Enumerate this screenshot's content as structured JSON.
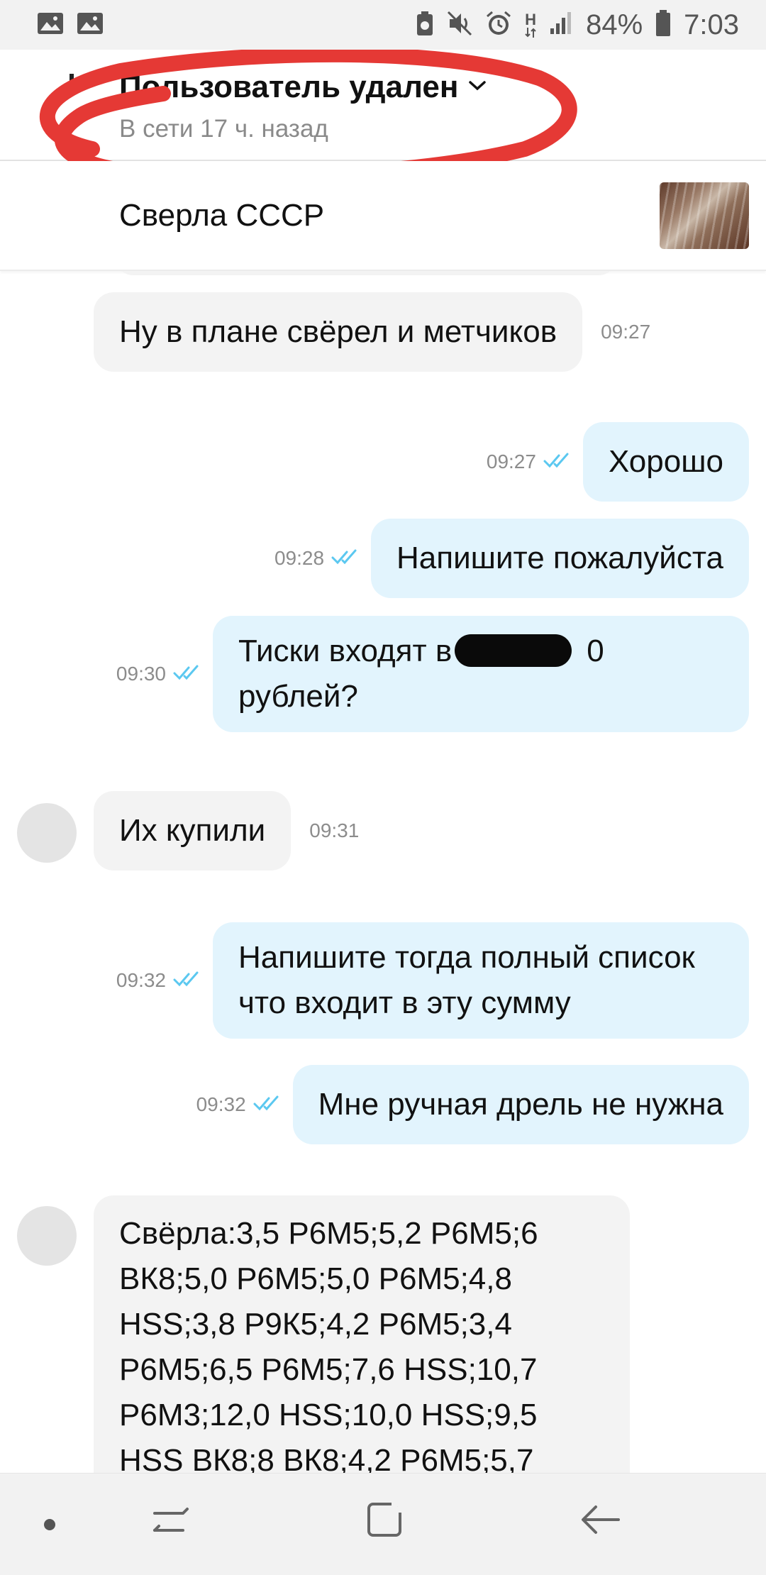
{
  "status_bar": {
    "battery": "84%",
    "time": "7:03",
    "network_label": "H",
    "left_icons": [
      "image-icon",
      "image-icon"
    ],
    "right_icons": [
      "battery-saver-icon",
      "mute-icon",
      "alarm-icon",
      "network-h-icon",
      "signal-icon",
      "battery-icon"
    ]
  },
  "header": {
    "name": "Пользователь удален",
    "status": "В сети 17 ч. назад",
    "annotation_color": "#e53935"
  },
  "item": {
    "title": "Сверла СССР"
  },
  "messages": [
    {
      "dir": "in",
      "text": "Ну в плане свёрел и метчиков",
      "time": "09:27"
    },
    {
      "dir": "out",
      "text": "Хорошо",
      "time": "09:27"
    },
    {
      "dir": "out",
      "text": "Напишите пожалуйста",
      "time": "09:28"
    },
    {
      "dir": "out",
      "text_line1_start": "Тиски входят в",
      "text_line1_end": "0",
      "text_line2": "рублей?",
      "time": "09:30",
      "redacted": true
    },
    {
      "dir": "in",
      "text": "Их купили",
      "time": "09:31"
    },
    {
      "dir": "out",
      "text": "Напишите тогда полный список что входит в эту сумму",
      "time": "09:32"
    },
    {
      "dir": "out",
      "text": "Мне ручная дрель не нужна",
      "time": "09:32"
    },
    {
      "dir": "in",
      "text": "Свёрла:3,5 Р6М5;5,2 Р6М5;6 ВК8;5,0 Р6М5;5,0 Р6М5;4,8 HSS;3,8 Р9К5;4,2 Р6М5;3,4 Р6М5;6,5 Р6М5;7,6  HSS;10,7 Р6М3;12,0 HSS;10,0 HSS;9,5 HSS ВК8;8 ВК8;4,2 Р6М5;5,7"
    }
  ],
  "colors": {
    "incoming_bubble": "#f3f3f3",
    "outgoing_bubble": "#e2f4fd",
    "read_check": "#5bc8f0"
  },
  "nav": [
    "dot-icon",
    "recent-apps-icon",
    "home-icon",
    "back-icon"
  ]
}
